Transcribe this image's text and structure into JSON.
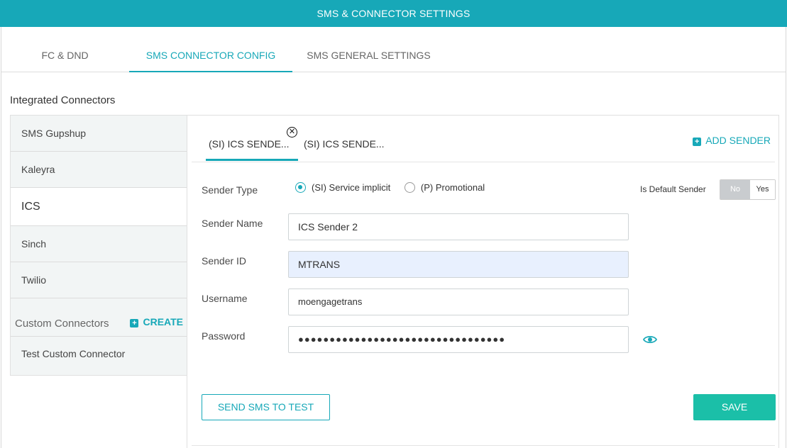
{
  "header": {
    "title": "SMS & CONNECTOR SETTINGS"
  },
  "tabs": [
    {
      "label": "FC & DND",
      "active": false
    },
    {
      "label": "SMS CONNECTOR CONFIG",
      "active": true
    },
    {
      "label": "SMS GENERAL SETTINGS",
      "active": false
    }
  ],
  "sidebar": {
    "title": "Integrated Connectors",
    "items": [
      {
        "label": "SMS Gupshup",
        "active": false
      },
      {
        "label": "Kaleyra",
        "active": false
      },
      {
        "label": "ICS",
        "active": true
      },
      {
        "label": "Sinch",
        "active": false
      },
      {
        "label": "Twilio",
        "active": false
      }
    ],
    "custom_title": "Custom Connectors",
    "create_label": "CREATE",
    "custom_items": [
      {
        "label": "Test Custom Connector"
      }
    ]
  },
  "sender_tabs": [
    {
      "label": "(SI) ICS SENDE...",
      "active": true
    },
    {
      "label": "(SI) ICS SENDE...",
      "active": false
    }
  ],
  "add_sender_label": "ADD SENDER",
  "form": {
    "sender_type_label": "Sender Type",
    "sender_type_options": [
      {
        "label": "(SI) Service implicit",
        "selected": true
      },
      {
        "label": "(P) Promotional",
        "selected": false
      }
    ],
    "default_sender_label": "Is Default Sender",
    "default_sender_no": "No",
    "default_sender_yes": "Yes",
    "default_sender_value": "No",
    "sender_name_label": "Sender Name",
    "sender_name_value": "ICS Sender 2",
    "sender_id_label": "Sender ID",
    "sender_id_value": "MTRANS",
    "username_label": "Username",
    "username_value": "moengagetrans",
    "password_label": "Password",
    "password_value": "●●●●●●●●●●●●●●●●●●●●●●●●●●●●●●●●●"
  },
  "buttons": {
    "send_test_label": "SEND SMS TO TEST",
    "save_label": "SAVE"
  },
  "colors": {
    "accent": "#17a8b8",
    "save": "#1bbfa8",
    "toggle_off": "#c9cccf"
  },
  "icons": {
    "close": "close-circle-icon",
    "add": "plus-square-icon",
    "password_visibility": "eye-icon"
  }
}
